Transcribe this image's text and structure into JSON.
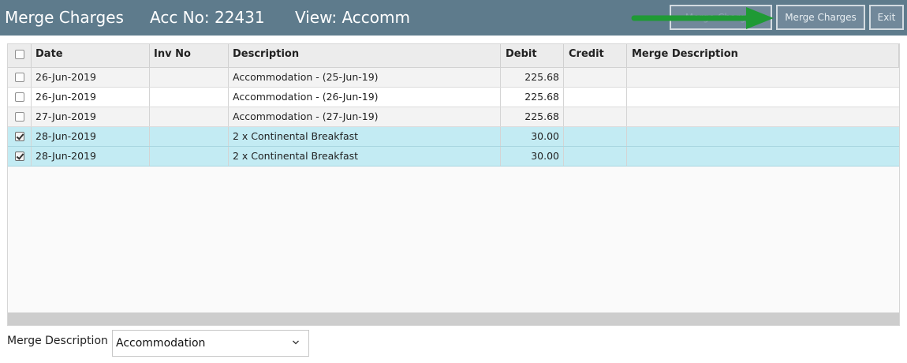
{
  "header": {
    "title": "Merge Charges",
    "account": "Acc No: 22431",
    "view": "View: Accomm",
    "buttons": {
      "hidden_label": "Merge Charges",
      "merge_label": "Merge Charges",
      "exit_label": "Exit"
    },
    "arrow_color": "#1f9a35",
    "bar_color": "#5e7b8c"
  },
  "grid": {
    "columns": [
      "Date",
      "Inv No",
      "Description",
      "Debit",
      "Credit",
      "Merge Description"
    ],
    "rows": [
      {
        "checked": false,
        "date": "26-Jun-2019",
        "inv_no": "",
        "description": "Accommodation - (25-Jun-19)",
        "debit": "225.68",
        "credit": "",
        "merge_description": ""
      },
      {
        "checked": false,
        "date": "26-Jun-2019",
        "inv_no": "",
        "description": "Accommodation - (26-Jun-19)",
        "debit": "225.68",
        "credit": "",
        "merge_description": ""
      },
      {
        "checked": false,
        "date": "27-Jun-2019",
        "inv_no": "",
        "description": "Accommodation - (27-Jun-19)",
        "debit": "225.68",
        "credit": "",
        "merge_description": ""
      },
      {
        "checked": true,
        "date": "28-Jun-2019",
        "inv_no": "",
        "description": "2 x Continental Breakfast",
        "debit": "30.00",
        "credit": "",
        "merge_description": ""
      },
      {
        "checked": true,
        "date": "28-Jun-2019",
        "inv_no": "",
        "description": "2 x Continental Breakfast",
        "debit": "30.00",
        "credit": "",
        "merge_description": ""
      }
    ],
    "selected_row_color": "#c3ebf3"
  },
  "footer": {
    "merge_label": "Merge Description",
    "merge_value": "Accommodation",
    "select_icon": "chevron-down-icon"
  }
}
